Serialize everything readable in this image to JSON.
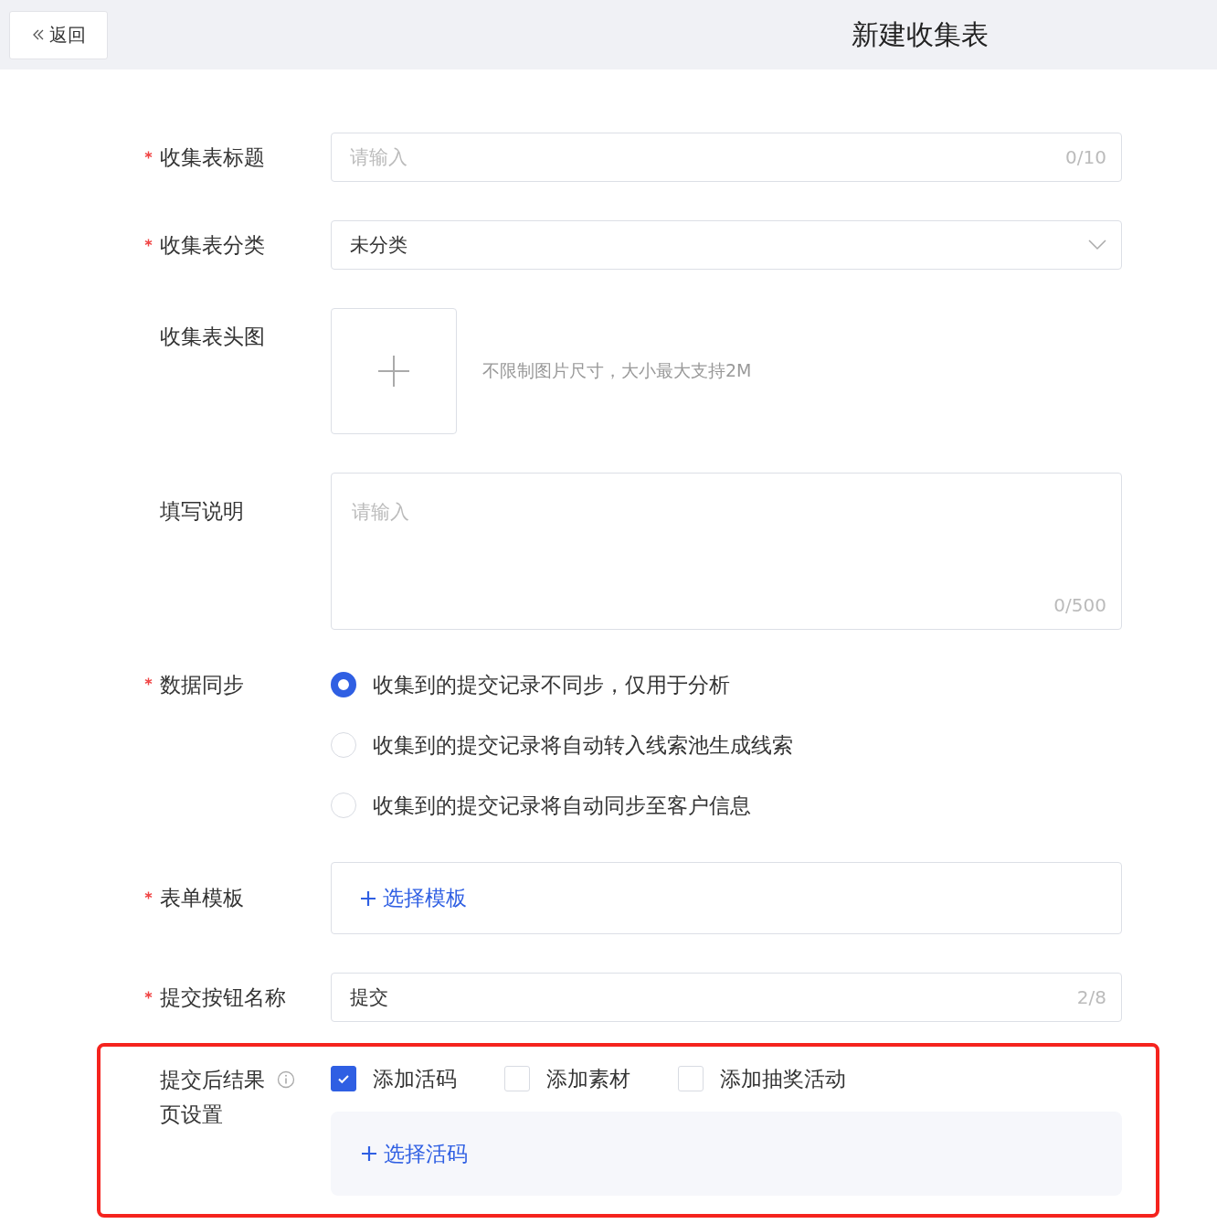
{
  "header": {
    "back_label": "返回",
    "title": "新建收集表"
  },
  "fields": [
    {
      "kind": "text",
      "label": "收集表标题",
      "required": true,
      "placeholder": "请输入",
      "counter": "0/10"
    },
    {
      "kind": "select",
      "label": "收集表分类",
      "required": true,
      "value": "未分类"
    },
    {
      "kind": "upload",
      "label": "收集表头图",
      "required": false,
      "hint": "不限制图片尺寸，大小最大支持2M"
    },
    {
      "kind": "textarea",
      "label": "填写说明",
      "required": false,
      "placeholder": "请输入",
      "counter": "0/500"
    },
    {
      "kind": "radio",
      "label": "数据同步",
      "required": true,
      "options": [
        {
          "label": "收集到的提交记录不同步，仅用于分析",
          "selected": true
        },
        {
          "label": "收集到的提交记录将自动转入线索池生成线索",
          "selected": false
        },
        {
          "label": "收集到的提交记录将自动同步至客户信息",
          "selected": false
        }
      ]
    },
    {
      "kind": "picker",
      "label": "表单模板",
      "required": true,
      "action": "选择模板"
    },
    {
      "kind": "text",
      "label": "提交按钮名称",
      "required": true,
      "value": "提交",
      "counter": "2/8"
    },
    {
      "kind": "checks",
      "label": "提交后结果页设置",
      "required": false,
      "info": true,
      "highlighted": true,
      "options": [
        {
          "label": "添加活码",
          "checked": true
        },
        {
          "label": "添加素材",
          "checked": false
        },
        {
          "label": "添加抽奖活动",
          "checked": false
        }
      ],
      "action": "选择活码"
    }
  ]
}
